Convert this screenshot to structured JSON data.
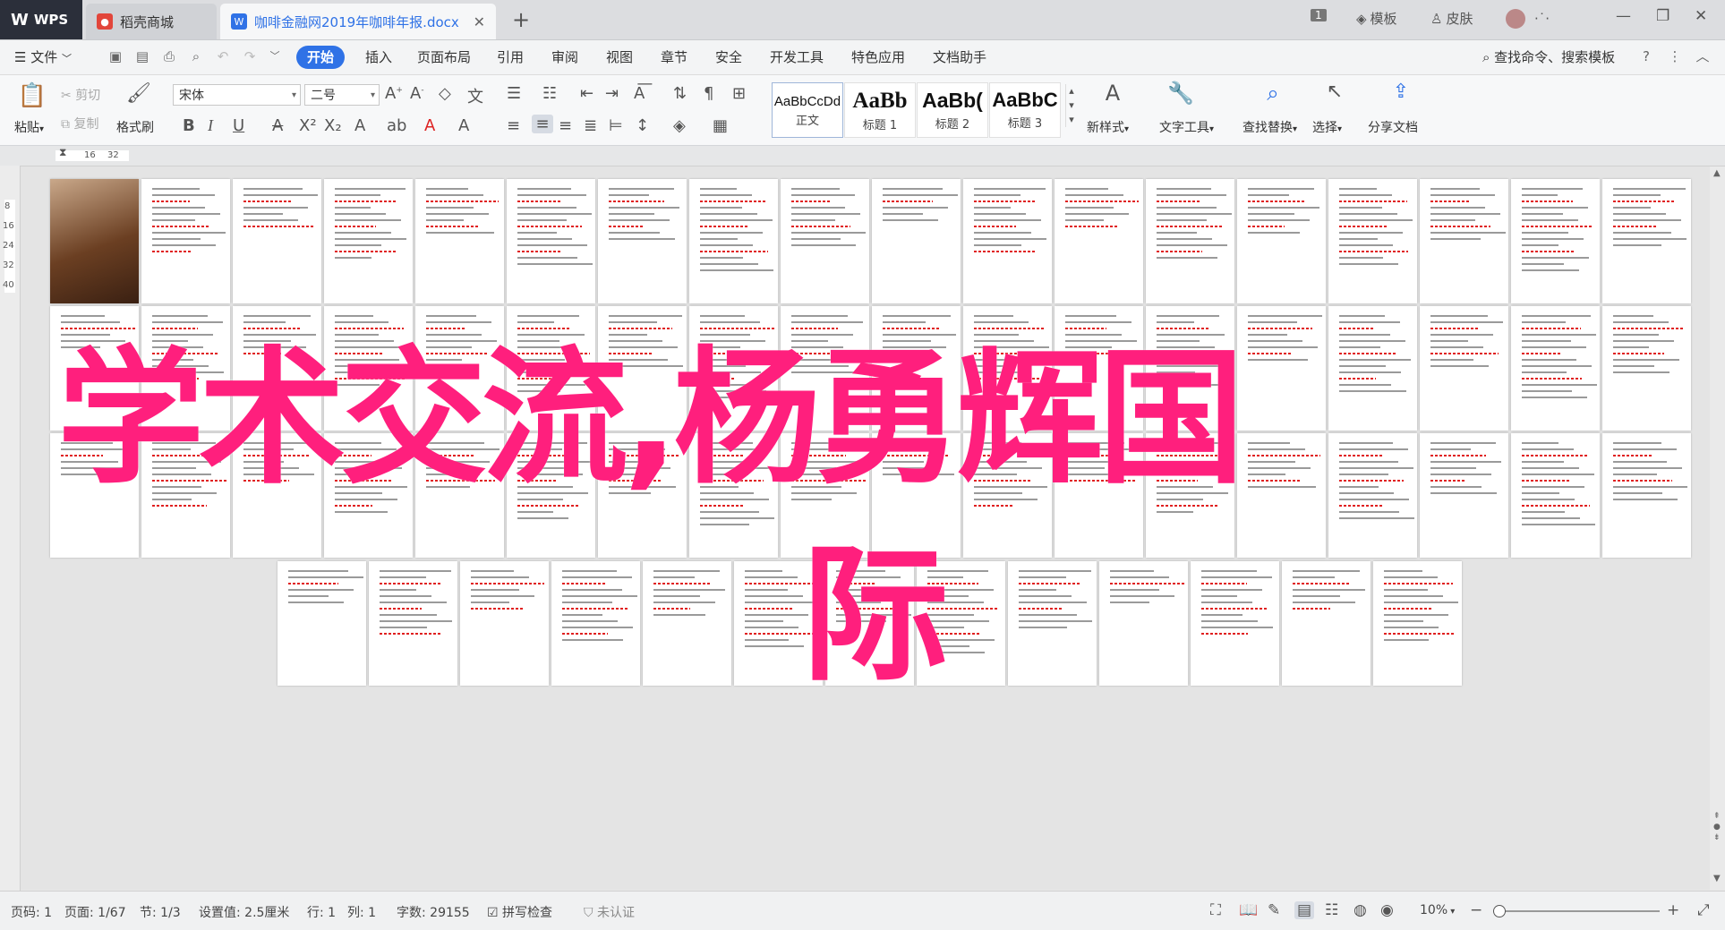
{
  "tabs": {
    "wps": "WPS",
    "store": "稻壳商城",
    "doc": "咖啡金融网2019年咖啡年报.docx",
    "page_badge": "1",
    "template": "模板",
    "skin": "皮肤"
  },
  "menu": {
    "file": "文件",
    "items": [
      "开始",
      "插入",
      "页面布局",
      "引用",
      "审阅",
      "视图",
      "章节",
      "安全",
      "开发工具",
      "特色应用",
      "文档助手"
    ],
    "search": "查找命令、搜索模板"
  },
  "ribbon": {
    "paste": "粘贴",
    "cut": "剪切",
    "copy": "复制",
    "format_painter": "格式刷",
    "font_name": "宋体",
    "font_size": "二号",
    "styles": [
      {
        "preview": "AaBbCcDd",
        "name": "正文"
      },
      {
        "preview": "AaBb",
        "name": "标题 1"
      },
      {
        "preview": "AaBb(",
        "name": "标题 2"
      },
      {
        "preview": "AaBbC",
        "name": "标题 3"
      }
    ],
    "new_style": "新样式",
    "text_tools": "文字工具",
    "find_replace": "查找替换",
    "select": "选择",
    "share_doc": "分享文档"
  },
  "ruler": {
    "h1": "16",
    "h2": "32",
    "v": [
      "8",
      "16",
      "24",
      "32",
      "40"
    ]
  },
  "watermark": {
    "line1": "学术交流,杨勇辉国",
    "line2": "际"
  },
  "status": {
    "page_no": "页码: 1",
    "page": "页面: 1/67",
    "section": "节: 1/3",
    "setting": "设置值: 2.5厘米",
    "row": "行: 1",
    "col": "列: 1",
    "words": "字数: 29155",
    "spell": "拼写检查",
    "auth": "未认证",
    "zoom": "10%"
  },
  "colors": {
    "accent": "#2f72e6",
    "watermark": "#ff1f7d",
    "wps_tab": "#2b2f3a"
  }
}
